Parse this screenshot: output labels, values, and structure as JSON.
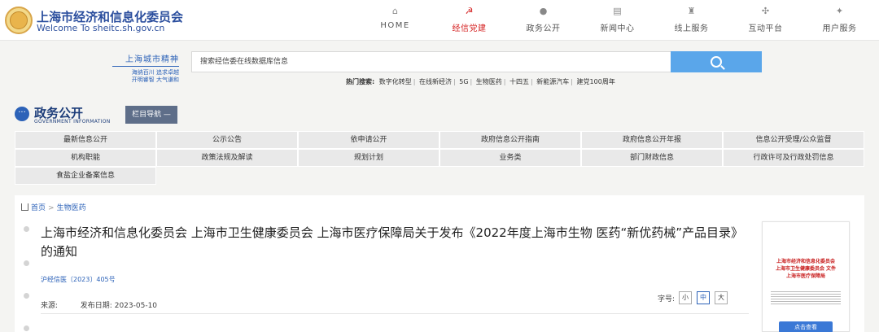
{
  "header": {
    "site_name": "上海市经济和信息化委员会",
    "site_sub": "Welcome To sheitc.sh.gov.cn",
    "nav": [
      {
        "label": "HOME",
        "icon": "home-icon",
        "glyph": "⌂"
      },
      {
        "label": "经信党建",
        "icon": "party-emblem-icon",
        "glyph": "☭"
      },
      {
        "label": "政务公开",
        "icon": "chat-bubble-icon",
        "glyph": "●"
      },
      {
        "label": "新闻中心",
        "icon": "news-icon",
        "glyph": "▤"
      },
      {
        "label": "线上服务",
        "icon": "service-icon",
        "glyph": "♜"
      },
      {
        "label": "互动平台",
        "icon": "interaction-icon",
        "glyph": "✣"
      },
      {
        "label": "用户服务",
        "icon": "user-service-icon",
        "glyph": "✦"
      }
    ],
    "active_color": "#d41f1f"
  },
  "search": {
    "spirit_title": "上海城市精神",
    "spirit_line1": "海纳百川 追求卓越",
    "spirit_line2": "开明睿智 大气谦和",
    "placeholder": "搜索经信委在线数据库信息",
    "button_color": "#5aa6ea",
    "hot_label": "热门搜索:",
    "hot_keywords": [
      "数字化转型",
      "在线新经济",
      "5G",
      "生物医药",
      "十四五",
      "新能源汽车",
      "建党100周年"
    ]
  },
  "gov": {
    "title": "政务公开",
    "subtitle": "GOVERNMENT INFORMATION",
    "column_nav": "栏目导航 —",
    "icon_glyph": "···"
  },
  "info_grid": [
    "最新信息公开",
    "公示公告",
    "依申请公开",
    "政府信息公开指南",
    "政府信息公开年报",
    "信息公开受理/公众监督",
    "机构职能",
    "政策法规及解读",
    "规划计划",
    "业务类",
    "部门财政信息",
    "行政许可及行政处罚信息",
    "食盐企业备案信息"
  ],
  "breadcrumb": {
    "home": "首页",
    "separator": ">",
    "current": "生物医药"
  },
  "article": {
    "title": "上海市经济和信息化委员会 上海市卫生健康委员会 上海市医疗保障局关于发布《2022年度上海市生物 医药“新优药械”产品目录》的通知",
    "doc_no": "沪经信医〔2023〕405号",
    "source_label": "来源:",
    "source_value": "",
    "date_label": "发布日期:",
    "date_value": "2023-05-10",
    "font_label": "字号:",
    "font_sizes": [
      "小",
      "中",
      "大"
    ],
    "font_selected": "中"
  },
  "thumbnail": {
    "header_line1": "上海市经济和信息化委员会",
    "header_line2": "上海市卫生健康委员会 文件",
    "header_line3": "上海市医疗保障局",
    "button": "点击查看"
  }
}
